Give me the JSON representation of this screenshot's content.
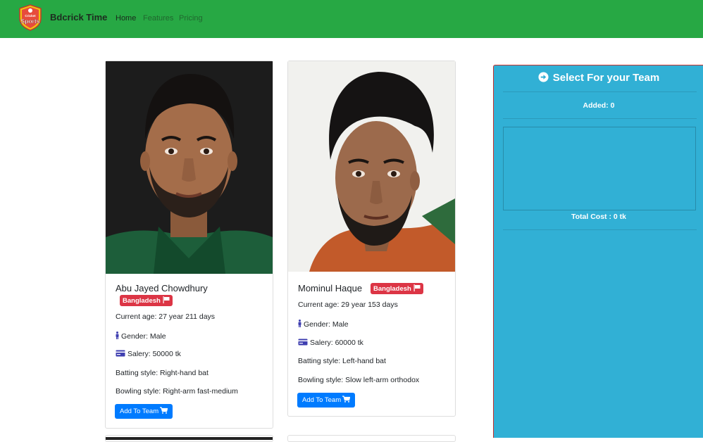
{
  "app": {
    "brand": "Bdcrick Time",
    "logo_text": [
      "Cricket",
      "Sports"
    ]
  },
  "nav": {
    "home": "Home",
    "features": "Features",
    "pricing": "Pricing"
  },
  "players": [
    {
      "name": "Abu Jayed Chowdhury",
      "country": "Bangladesh",
      "age": "Current age: 27 year 211 days",
      "gender": "Gender: Male",
      "salary": "Salery: 50000 tk",
      "batting": "Batting style: Right-hand bat",
      "bowling": "Bowling style: Right-arm fast-medium",
      "button": "Add To Team"
    },
    {
      "name": "Mominul Haque",
      "country": "Bangladesh",
      "age": "Current age: 29 year 153 days",
      "gender": "Gender: Male",
      "salary": "Salery: 60000 tk",
      "batting": "Batting style: Left-hand bat",
      "bowling": "Bowling style: Slow left-arm orthodox",
      "button": "Add To Team"
    }
  ],
  "team_panel": {
    "title": "Select For your Team",
    "added": "Added: 0",
    "total_cost": "Total Cost : 0 tk"
  },
  "colors": {
    "navbar": "#27a844",
    "badge": "#dc3545",
    "button": "#007bff",
    "panel": "#31b0d5"
  },
  "icons": [
    "logo-icon",
    "flag-icon",
    "male-icon",
    "credit-card-icon",
    "cart-icon",
    "arrow-circle-right-icon"
  ]
}
